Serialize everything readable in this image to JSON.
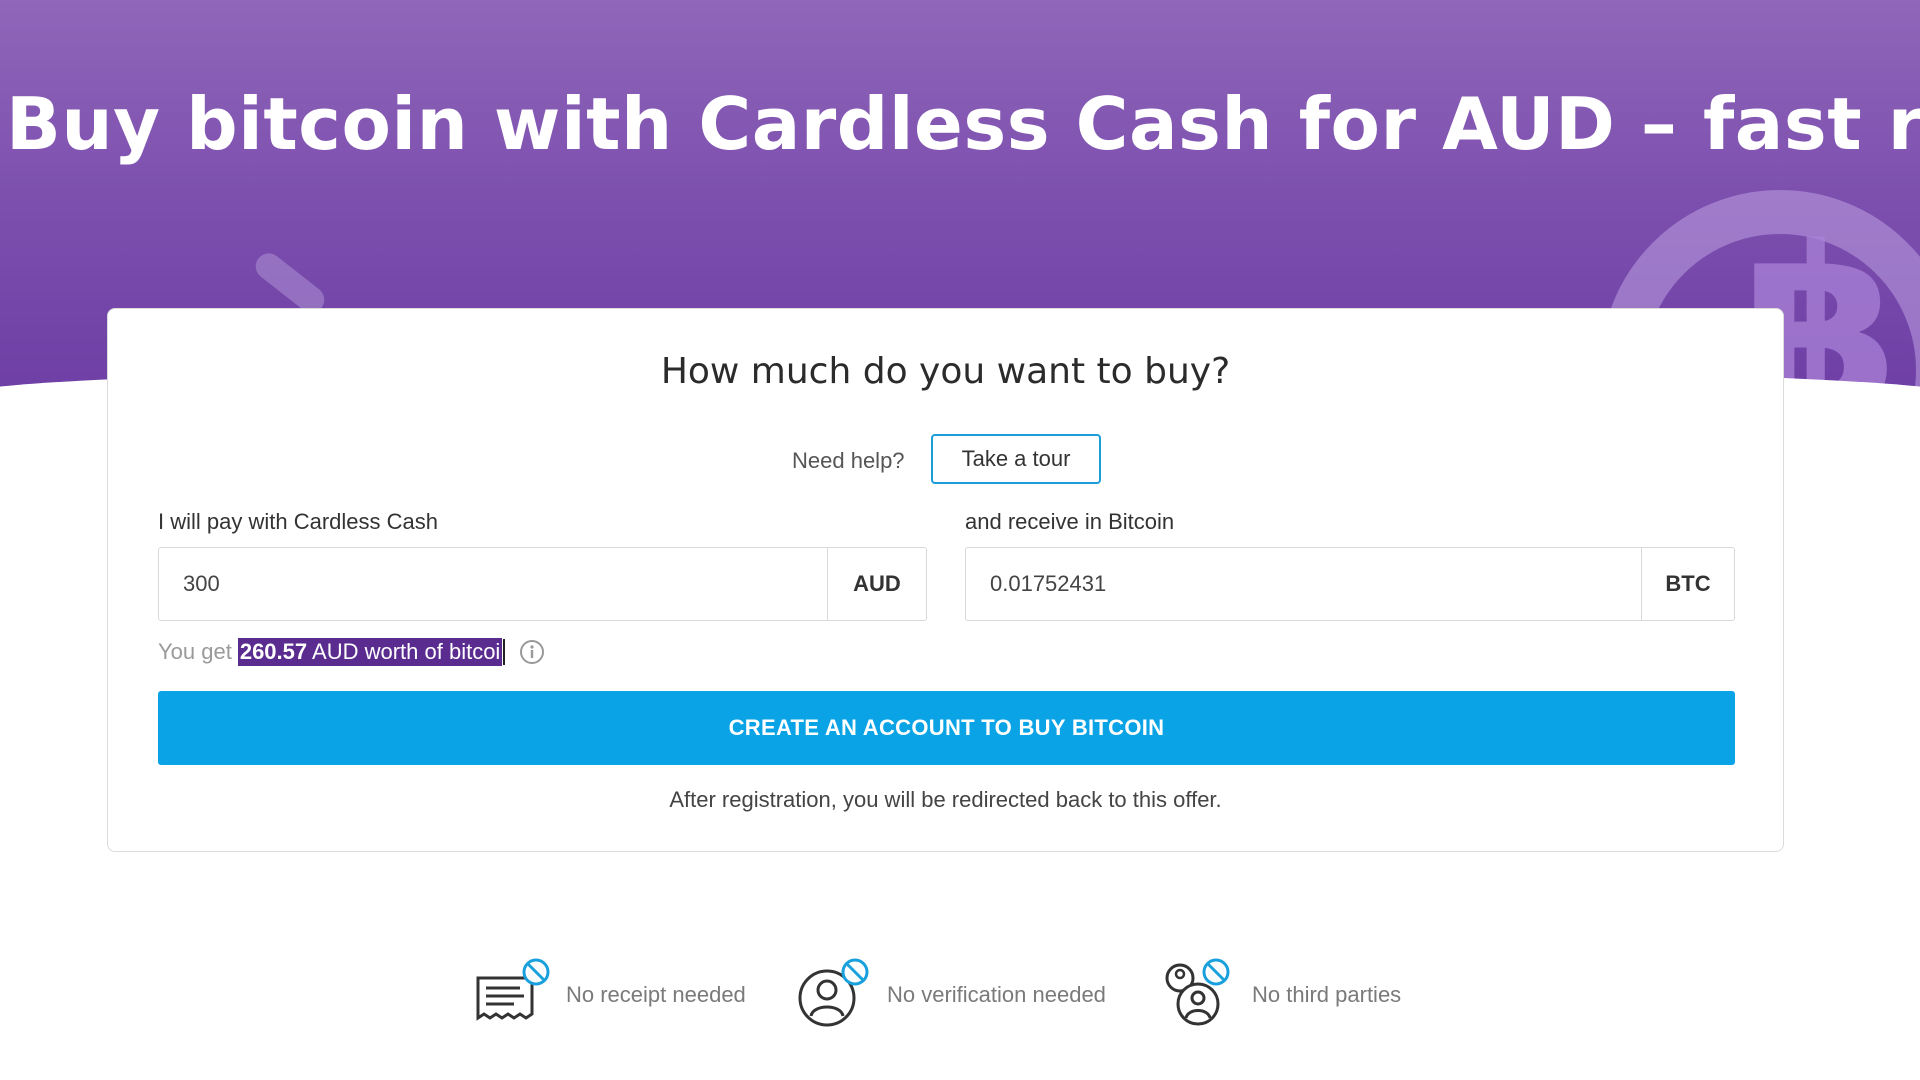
{
  "hero": {
    "title": "Buy bitcoin with Cardless Cash for AUD – fast realse"
  },
  "card": {
    "heading": "How much do you want to buy?",
    "help_label": "Need help?",
    "tour_button": "Take a tour",
    "pay": {
      "label": "I will pay with Cardless Cash",
      "value": "300",
      "currency": "AUD"
    },
    "receive": {
      "label": "and receive in Bitcoin",
      "value": "0.01752431",
      "currency": "BTC"
    },
    "you_get_prefix": "You get",
    "you_get_amount": "260.57",
    "you_get_suffix": " AUD worth of bitcoi",
    "cta_button": "CREATE AN ACCOUNT TO BUY BITCOIN",
    "after_note": "After registration, you will be redirected back to this offer."
  },
  "features": [
    {
      "label": "No receipt needed",
      "icon": "receipt-icon"
    },
    {
      "label": "No verification needed",
      "icon": "user-icon"
    },
    {
      "label": "No third parties",
      "icon": "group-icon"
    }
  ],
  "colors": {
    "hero_purple": "#7c4fae",
    "cta_blue": "#0aa3e6",
    "tour_border": "#1a9fd8",
    "selection": "#5b2c8f"
  }
}
